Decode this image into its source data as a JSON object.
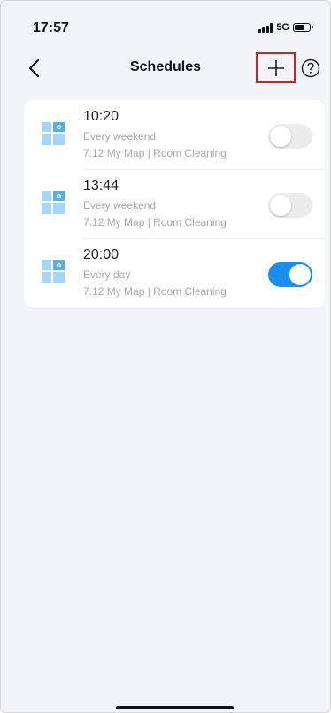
{
  "status_bar": {
    "time": "17:57",
    "network": "5G",
    "icons": [
      "signal-icon",
      "battery-icon"
    ]
  },
  "header": {
    "title": "Schedules",
    "back_icon": "chevron-left-icon",
    "add_icon": "plus-icon",
    "help_icon": "question-circle-icon",
    "add_highlight_color": "#cc2229"
  },
  "schedules": [
    {
      "time": "10:20",
      "repeat": "Every weekend",
      "detail": "7.12 My Map | Room Cleaning",
      "enabled": false
    },
    {
      "time": "13:44",
      "repeat": "Every weekend",
      "detail": "7.12 My Map | Room Cleaning",
      "enabled": false
    },
    {
      "time": "20:00",
      "repeat": "Every day",
      "detail": "7.12 My Map | Room Cleaning",
      "enabled": true
    }
  ],
  "colors": {
    "toggle_on": "#1a8df0",
    "toggle_off": "#ececec",
    "map_icon": "#5aaee8",
    "background": "#f3f4f6"
  }
}
